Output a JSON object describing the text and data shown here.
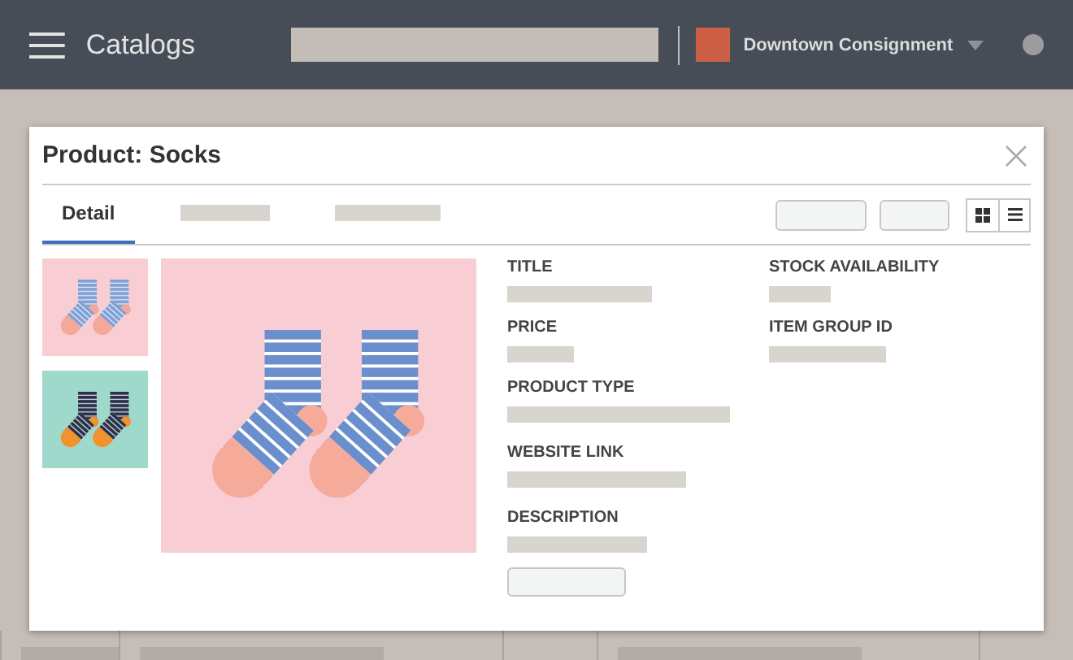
{
  "header": {
    "title": "Catalogs",
    "store": {
      "name": "Downtown Consignment",
      "color": "#cd5f45"
    }
  },
  "dialog": {
    "title": "Product: Socks",
    "tabs": [
      {
        "label": "Detail",
        "selected": true
      },
      {
        "selected": false
      },
      {
        "selected": false
      }
    ],
    "fields": [
      {
        "label": "TITLE",
        "kind": "plain"
      },
      {
        "label": "PRICE",
        "kind": "plain"
      },
      {
        "label": "PRODUCT TYPE",
        "kind": "plain"
      },
      {
        "label": "WEBSITE LINK",
        "kind": "plain"
      },
      {
        "label": "DESCRIPTION",
        "kind": "with-button"
      }
    ],
    "side_fields": [
      {
        "label": "STOCK AVAILABILITY",
        "kind": "plain"
      },
      {
        "label": "ITEM GROUP ID",
        "kind": "plain"
      }
    ]
  }
}
